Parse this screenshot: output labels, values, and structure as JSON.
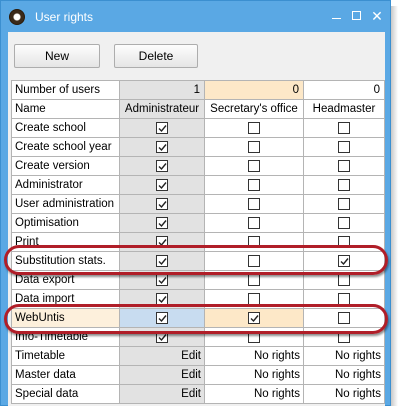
{
  "window": {
    "title": "User rights",
    "icon": "app-clock-icon"
  },
  "toolbar": {
    "new_label": "New",
    "delete_label": "Delete"
  },
  "grid": {
    "count_row": {
      "label": "Number of users",
      "values": [
        "1",
        "0",
        "0"
      ]
    },
    "header_row": {
      "label": "Name",
      "groups": [
        "Administrateur",
        "Secretary's office",
        "Headmaster"
      ]
    },
    "checkbox_rows": [
      {
        "label": "Create school",
        "values": [
          true,
          false,
          false
        ]
      },
      {
        "label": "Create school year",
        "values": [
          true,
          false,
          false
        ]
      },
      {
        "label": "Create version",
        "values": [
          true,
          false,
          false
        ]
      },
      {
        "label": "Administrator",
        "values": [
          true,
          false,
          false
        ]
      },
      {
        "label": "User administration",
        "values": [
          true,
          false,
          false
        ]
      },
      {
        "label": "Optimisation",
        "values": [
          true,
          false,
          false
        ]
      },
      {
        "label": "Print",
        "values": [
          true,
          false,
          false
        ]
      },
      {
        "label": "Substitution stats.",
        "values": [
          true,
          false,
          true
        ]
      },
      {
        "label": "Data export",
        "values": [
          true,
          false,
          false
        ]
      },
      {
        "label": "Data import",
        "values": [
          true,
          false,
          false
        ]
      },
      {
        "label": "WebUntis",
        "values": [
          true,
          true,
          false
        ]
      },
      {
        "label": "Info-Timetable",
        "values": [
          true,
          false,
          false
        ]
      }
    ],
    "text_rows": [
      {
        "label": "Timetable",
        "values": [
          "Edit",
          "No rights",
          "No rights"
        ]
      },
      {
        "label": "Master data",
        "values": [
          "Edit",
          "No rights",
          "No rights"
        ]
      },
      {
        "label": "Special data",
        "values": [
          "Edit",
          "No rights",
          "No rights"
        ]
      }
    ]
  },
  "highlight_color": "#b01e28"
}
